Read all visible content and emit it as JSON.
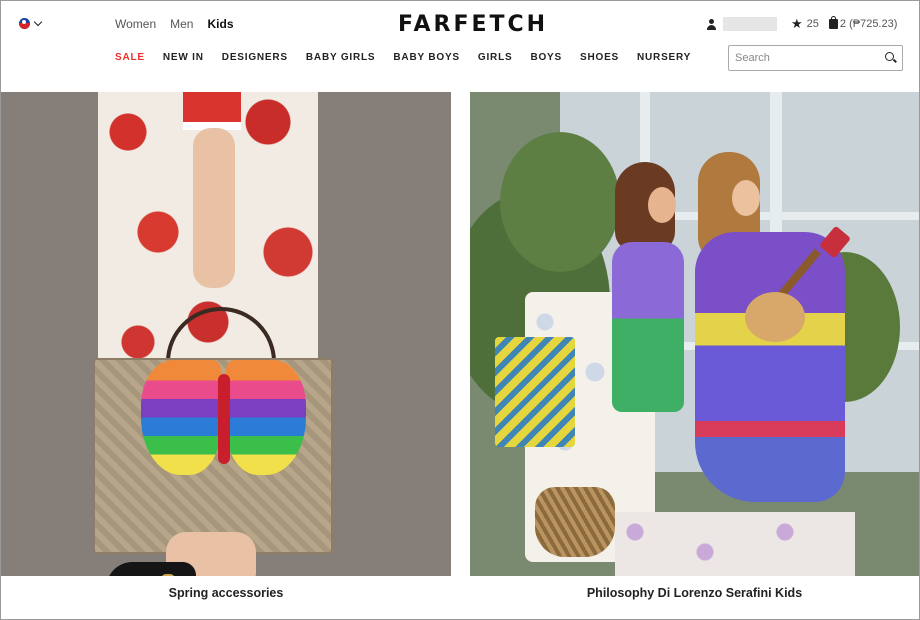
{
  "header": {
    "gender_tabs": [
      {
        "label": "Women",
        "active": false
      },
      {
        "label": "Men",
        "active": false
      },
      {
        "label": "Kids",
        "active": true
      }
    ],
    "logo": "FARFETCH",
    "nav": [
      "SALE",
      "NEW IN",
      "DESIGNERS",
      "BABY GIRLS",
      "BABY BOYS",
      "GIRLS",
      "BOYS",
      "SHOES",
      "NURSERY"
    ],
    "wishlist_count": "25",
    "bag_text": "2 (₱725.23)",
    "search": {
      "placeholder": "Search",
      "value": ""
    },
    "icons": {
      "flag": "philippines-flag-icon",
      "user": "user-icon",
      "wishlist": "star-icon",
      "bag": "bag-icon",
      "search": "search-icon"
    }
  },
  "tiles": [
    {
      "caption": "Spring accessories"
    },
    {
      "caption": "Philosophy Di Lorenzo Serafini Kids"
    }
  ],
  "colors": {
    "sale": "#e8322f",
    "text": "#222222",
    "border": "#aaaaaa"
  }
}
